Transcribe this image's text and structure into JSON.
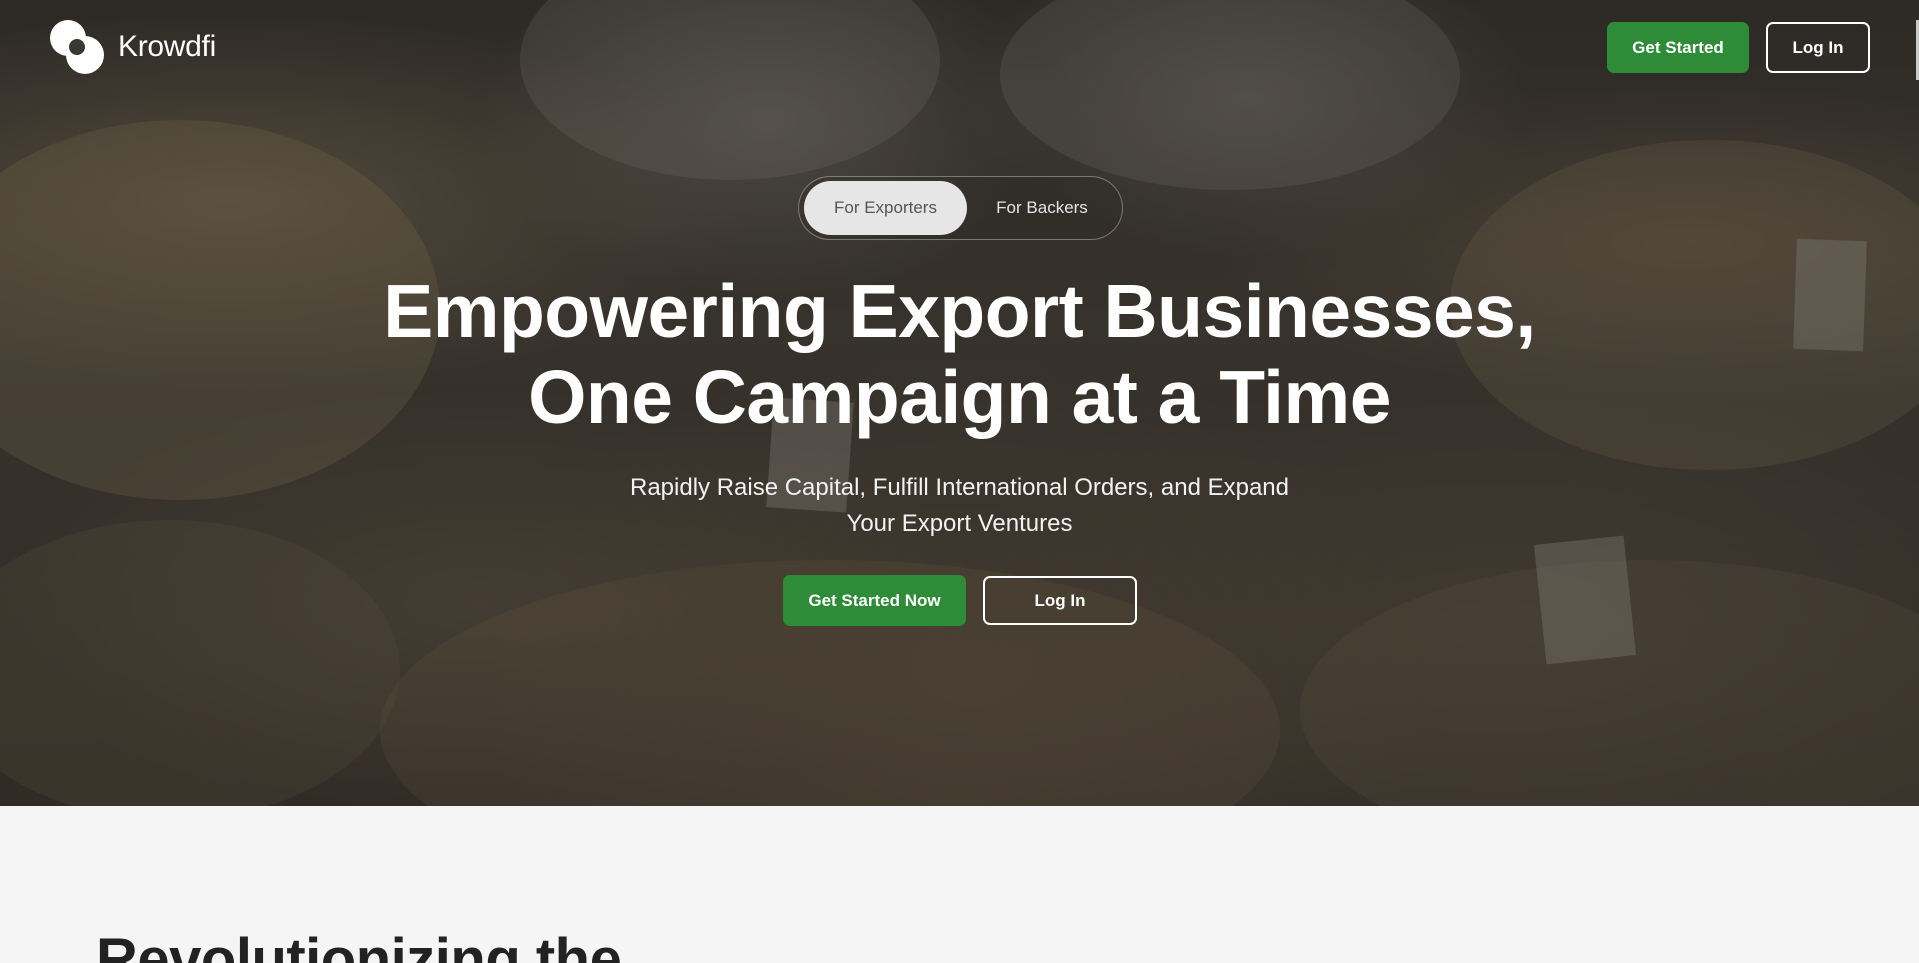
{
  "brand": {
    "name": "Krowdfi",
    "logo_icon": "krowdfi-logo-icon"
  },
  "nav": {
    "get_started": "Get Started",
    "log_in": "Log In"
  },
  "audience_toggle": {
    "options": [
      "For Exporters",
      "For Backers"
    ],
    "selected": "For Exporters"
  },
  "hero": {
    "headline_line1": "Empowering Export Businesses,",
    "headline_line2": "One Campaign at a Time",
    "subheadline_line1": "Rapidly Raise Capital, Fulfill International Orders, and Expand",
    "subheadline_line2": "Your Export Ventures",
    "cta_primary": "Get Started Now",
    "cta_secondary": "Log In"
  },
  "section": {
    "heading": "Revolutionizing the"
  },
  "colors": {
    "accent_green": "#2e8b38",
    "text_on_dark": "#ffffff",
    "section_bg": "#f5f5f5"
  }
}
